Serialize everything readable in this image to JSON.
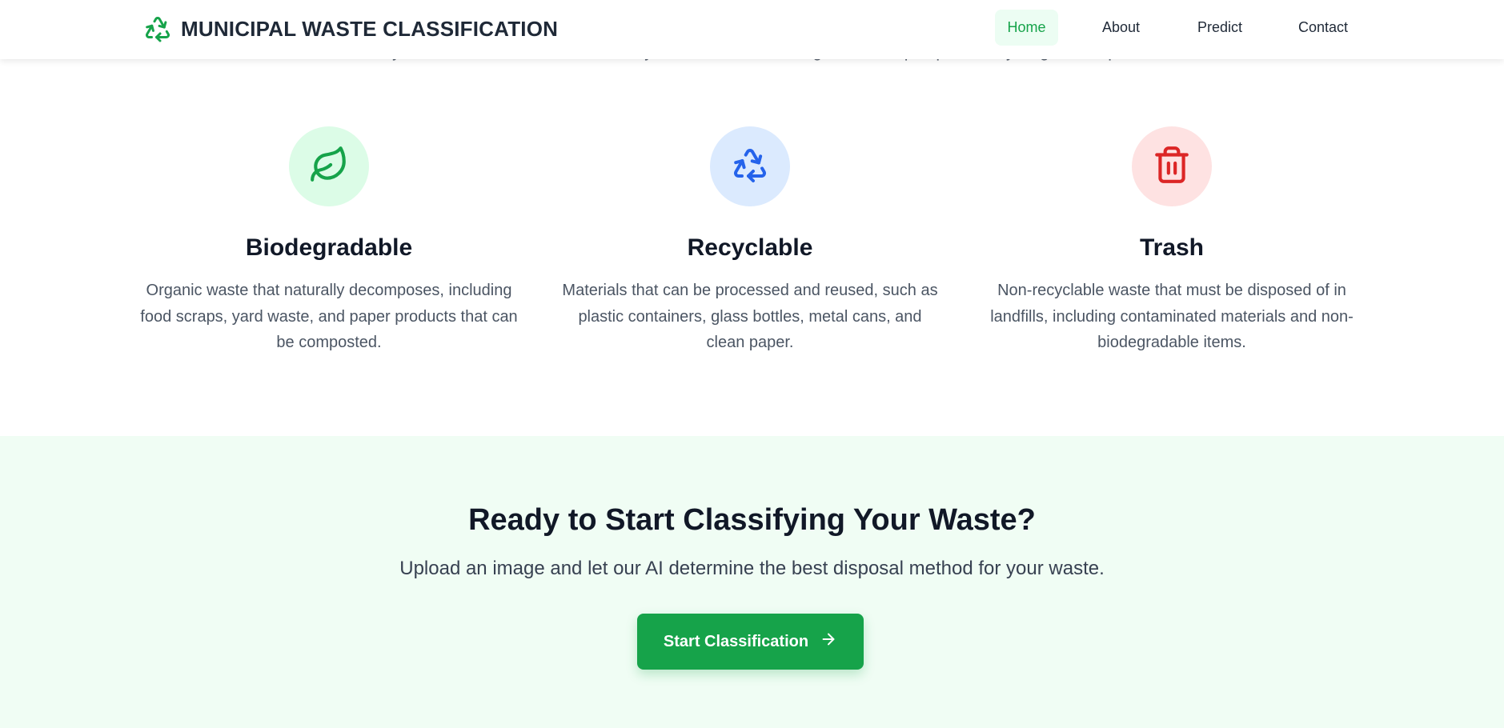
{
  "header": {
    "brand_icon": "recycle-icon",
    "brand_title": "MUNICIPAL WASTE CLASSIFICATION",
    "accent_color": "#16a34a",
    "nav": [
      {
        "label": "Home",
        "active": true
      },
      {
        "label": "About",
        "active": false
      },
      {
        "label": "Predict",
        "active": false
      },
      {
        "label": "Contact",
        "active": false
      }
    ]
  },
  "intro_partial": "Our system uses advanced AI to classify waste into three categories to help improve recycling and disposal.",
  "categories": [
    {
      "icon": "leaf-icon",
      "icon_color": "#16a34a",
      "circle_color": "#dcfce7",
      "title": "Biodegradable",
      "description": "Organic waste that naturally decomposes, including food scraps, yard waste, and paper products that can be composted."
    },
    {
      "icon": "recycle-icon",
      "icon_color": "#2563eb",
      "circle_color": "#dbeafe",
      "title": "Recyclable",
      "description": "Materials that can be processed and reused, such as plastic containers, glass bottles, metal cans, and clean paper."
    },
    {
      "icon": "trash-icon",
      "icon_color": "#dc2626",
      "circle_color": "#fee2e2",
      "title": "Trash",
      "description": "Non-recyclable waste that must be disposed of in landfills, including contaminated materials and non-biodegradable items."
    }
  ],
  "cta": {
    "title": "Ready to Start Classifying Your Waste?",
    "subtitle": "Upload an image and let our AI determine the best disposal method for your waste.",
    "button_label": "Start Classification",
    "button_icon": "arrow-right-icon",
    "background": "#f0fdf4"
  }
}
